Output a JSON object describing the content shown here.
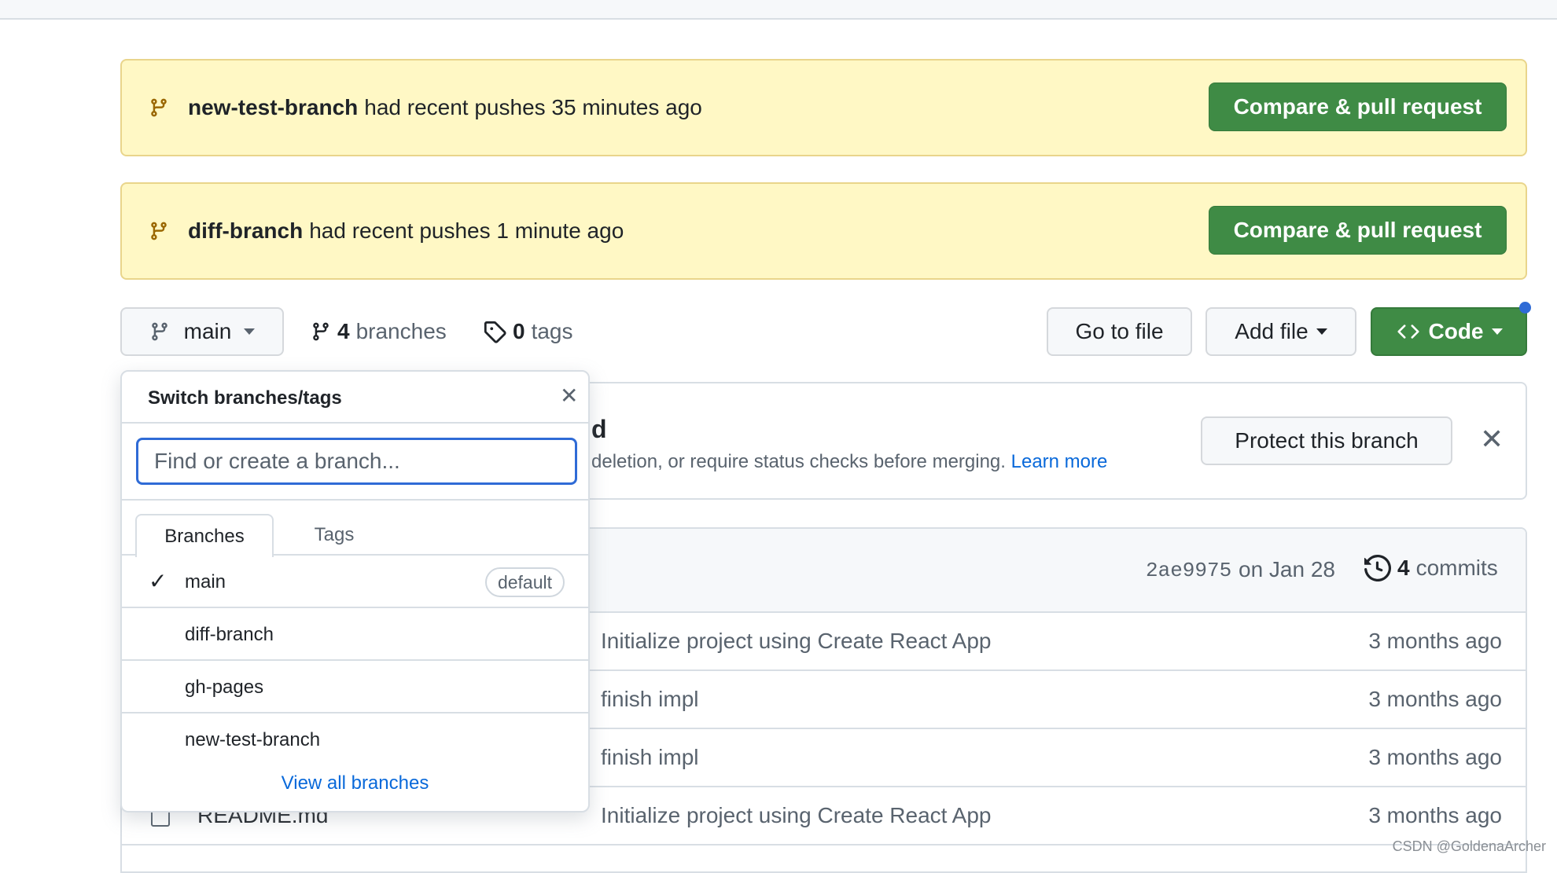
{
  "banners": [
    {
      "branch": "new-test-branch",
      "message": "had recent pushes 35 minutes ago",
      "button": "Compare & pull request"
    },
    {
      "branch": "diff-branch",
      "message": "had recent pushes 1 minute ago",
      "button": "Compare & pull request"
    }
  ],
  "toolbar": {
    "current_branch": "main",
    "branch_count": "4",
    "branches_label": "branches",
    "tag_count": "0",
    "tags_label": "tags",
    "go_to_file": "Go to file",
    "add_file": "Add file",
    "code": "Code"
  },
  "protect": {
    "title_fragment": "d",
    "text_fragment": "deletion, or require status checks before merging.",
    "learn_more": "Learn more",
    "button": "Protect this branch"
  },
  "commit_header": {
    "sha": "2ae9975",
    "date": "on Jan 28",
    "commit_count": "4",
    "commits_label": "commits"
  },
  "files": [
    {
      "name": "",
      "message": "Initialize project using Create React App",
      "time": "3 months ago"
    },
    {
      "name": "",
      "message": "finish impl",
      "time": "3 months ago"
    },
    {
      "name": "",
      "message": "finish impl",
      "time": "3 months ago"
    },
    {
      "name": "README.md",
      "message": "Initialize project using Create React App",
      "time": "3 months ago"
    }
  ],
  "dropdown": {
    "title": "Switch branches/tags",
    "placeholder": "Find or create a branch...",
    "tabs": [
      "Branches",
      "Tags"
    ],
    "branches": [
      {
        "name": "main",
        "badge": "default",
        "selected": true
      },
      {
        "name": "diff-branch"
      },
      {
        "name": "gh-pages"
      },
      {
        "name": "new-test-branch"
      }
    ],
    "view_all": "View all branches"
  },
  "watermark": "CSDN @GoldenaArcher",
  "colors": {
    "green": "#3f8b45",
    "banner": "#fff8c5",
    "link": "#0969da",
    "focus": "#2f6bd6"
  }
}
